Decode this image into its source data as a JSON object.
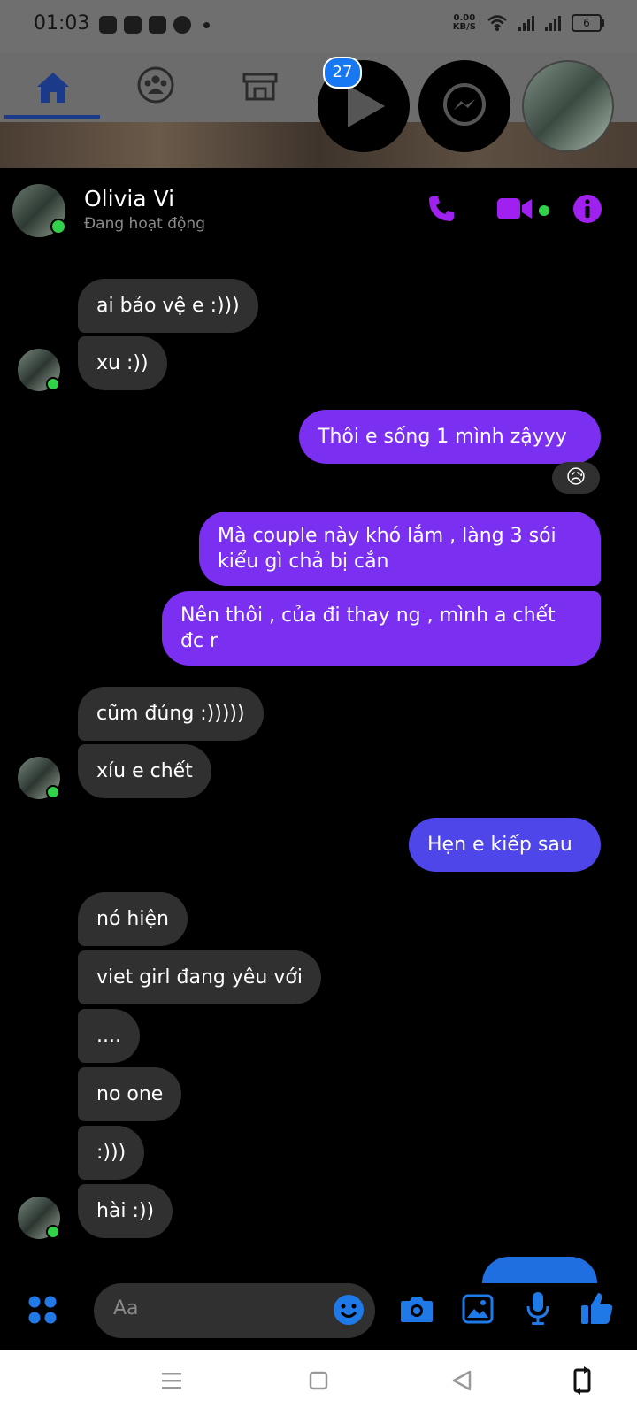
{
  "status_bar": {
    "time": "01:03",
    "net_speed_value": "0.00",
    "net_speed_unit": "KB/S",
    "battery": "6",
    "icons": [
      "discord-icon",
      "zalo-icon",
      "instagram-icon",
      "chelsea-icon",
      "dot-icon",
      "wifi-icon",
      "signal-icon",
      "signal-icon",
      "battery-icon"
    ]
  },
  "facebook_nav": {
    "tabs": [
      "home-icon",
      "groups-icon",
      "marketplace-icon"
    ],
    "chat_heads": [
      "watch-icon",
      "messenger-icon",
      "profile-avatar"
    ],
    "watch_badge": "27"
  },
  "chat": {
    "contact_name": "Olivia Vi",
    "contact_status": "Đang hoạt động",
    "header_actions": [
      "phone-icon",
      "video-icon",
      "info-icon"
    ],
    "accent_color": "#7b2ff0",
    "messages": [
      {
        "side": "in",
        "text": "ai bảo vệ e :)))"
      },
      {
        "side": "in",
        "text": "xu :))"
      },
      {
        "side": "out",
        "text": "Thôi e sống 1 mình zậyyy",
        "reaction": "😥"
      },
      {
        "side": "out",
        "text": "Mà couple này khó lắm , làng 3 sói kiểu gì chả bị cắn"
      },
      {
        "side": "out",
        "text": "Nên thôi , của đi thay ng , mình a chết đc r"
      },
      {
        "side": "in",
        "text": "cũm đúng :)))))"
      },
      {
        "side": "in",
        "text": "xíu e chết"
      },
      {
        "side": "out",
        "text": "Hẹn e kiếp sau"
      },
      {
        "side": "in",
        "text": "nó hiện"
      },
      {
        "side": "in",
        "text": "viet girl đang yêu với"
      },
      {
        "side": "in",
        "text": "...."
      },
      {
        "side": "in",
        "text": "no one"
      },
      {
        "side": "in",
        "text": ":)))"
      },
      {
        "side": "in",
        "text": "hài :))"
      }
    ]
  },
  "composer": {
    "placeholder": "Aa",
    "actions": [
      "apps-icon",
      "emoji-icon",
      "camera-icon",
      "gallery-icon",
      "mic-icon",
      "like-icon"
    ]
  },
  "android_nav": [
    "menu-icon",
    "home-square-icon",
    "back-icon",
    "rotate-icon"
  ]
}
